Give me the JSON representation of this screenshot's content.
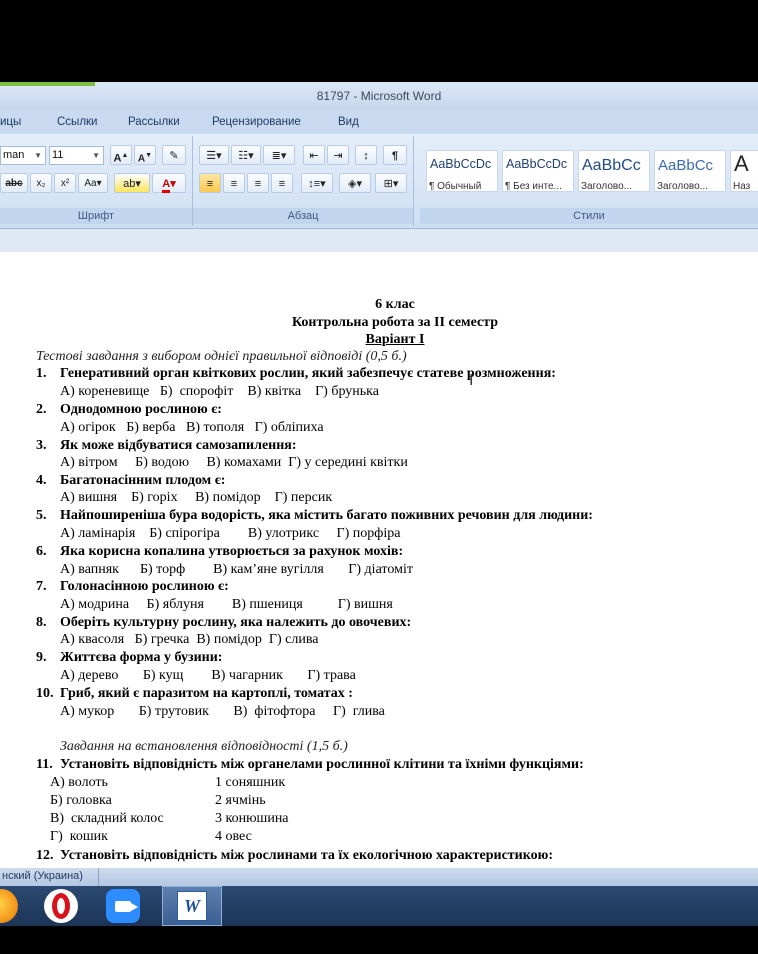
{
  "window": {
    "title": "81797 - Microsoft Word"
  },
  "tabs": [
    "ицы",
    "Ссылки",
    "Рассылки",
    "Рецензирование",
    "Вид"
  ],
  "ribbon": {
    "font_name": "man",
    "font_size": "11",
    "groups": {
      "font": "Шрифт",
      "paragraph": "Абзац",
      "styles": "Стили"
    },
    "styles": [
      {
        "sample": "AaBbCcDc",
        "name": "¶ Обычный"
      },
      {
        "sample": "AaBbCcDc",
        "name": "¶ Без инте..."
      },
      {
        "sample": "AaBbCc",
        "name": "Заголово..."
      },
      {
        "sample": "AaBbCc",
        "name": "Заголово..."
      },
      {
        "sample": "A",
        "name": "Наз"
      }
    ]
  },
  "document": {
    "heading1": "6 клас",
    "heading2": "Контрольна робота за ІІ семестр",
    "heading3": "Варіант І",
    "section1": "Тестові завдання з вибором однієї правильної відповіді (0,5 б.)",
    "questions": [
      {
        "n": "1.",
        "q": "Генеративний орган квіткових рослин, який забезпечує статеве розмноження:",
        "a": "А) кореневище   Б)  спорофіт    В) квітка    Г) брунька"
      },
      {
        "n": "2.",
        "q": "Однодомною рослиною є:",
        "a": "А) огірок   Б) верба   В) тополя   Г) обліпиха"
      },
      {
        "n": "3.",
        "q": "Як може відбуватися самозапилення:",
        "a": "А) вітром     Б) водою     В) комахами  Г) у середині квітки"
      },
      {
        "n": "4.",
        "q": "Багатонасінним плодом є:",
        "a": "А) вишня    Б) горіх     В) помідор    Г) персик"
      },
      {
        "n": "5.",
        "q": "Найпоширеніша бура водорість, яка містить багато поживних речовин для людини:",
        "a": "А) ламінарія    Б) спірогіра        В) улотрикс     Г) порфіра"
      },
      {
        "n": "6.",
        "q": "Яка корисна копалина утворюється за рахунок мохів:",
        "a": "А) вапняк      Б) торф        В) кам’яне вугілля       Г) діатоміт"
      },
      {
        "n": "7.",
        "q": "Голонасінною рослиною є:",
        "a": "А) модрина     Б) яблуня        В) пшениця          Г) вишня"
      },
      {
        "n": "8.",
        "q": "Оберіть культурну рослину, яка належить до овочевих:",
        "a": "А) квасоля   Б) гречка  В) помідор  Г) слива"
      },
      {
        "n": "9.",
        "q": "Життєва форма у бузини:",
        "a": "А) дерево       Б) кущ        В) чагарник       Г) трава"
      },
      {
        "n": "10.",
        "q": "Гриб, який є паразитом на картоплі, томатах  :",
        "a": "А) мукор       Б) трутовик       В)  фітофтора     Г)  глива"
      }
    ],
    "section2": "Завдання на встановлення відповідності (1,5 б.)",
    "q11": {
      "n": "11.",
      "q": "Установіть відповідність між органелами рослинної клітини та їхніми функціями:"
    },
    "matching_left": [
      "А) волоть",
      "Б) головка",
      "В)  складний колос",
      "Г)  кошик"
    ],
    "matching_right": [
      "1 соняшник",
      "2 ячмінь",
      "3 конюшина",
      "4 овес"
    ],
    "q12": {
      "n": "12.",
      "q": "Установіть відповідність між рослинами та їх екологічною  характеристикою:"
    }
  },
  "status_bar": {
    "language": "нский (Украина)"
  },
  "taskbar": {
    "word_label": "W"
  }
}
